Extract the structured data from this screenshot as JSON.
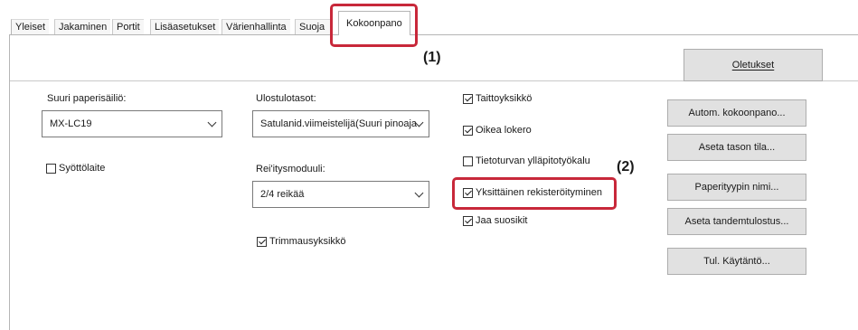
{
  "tabs": [
    {
      "label": "Yleiset"
    },
    {
      "label": "Jakaminen"
    },
    {
      "label": "Portit"
    },
    {
      "label": "Lisäasetukset"
    },
    {
      "label": "Värienhallinta"
    },
    {
      "label": "Suoja"
    },
    {
      "label": "Kokoonpano"
    }
  ],
  "left": {
    "tray_label": "Suuri paperisäiliö:",
    "tray_value": "MX-LC19",
    "feeder_label": "Syöttölaite",
    "feeder_checked": false
  },
  "middle": {
    "output_label": "Ulostulotasot:",
    "output_value": "Satulanid.viimeistelijä(Suuri pinoaja",
    "punch_label": "Rei'itysmoduuli:",
    "punch_value": "2/4 reikää",
    "trim_label": "Trimmausyksikkö",
    "trim_checked": true
  },
  "options": [
    {
      "label": "Taittoyksikkö",
      "checked": true
    },
    {
      "label": "Oikea lokero",
      "checked": true
    },
    {
      "label": "Tietoturvan ylläpitotyökalu",
      "checked": false
    },
    {
      "label": "Yksittäinen rekisteröityminen",
      "checked": true
    },
    {
      "label": "Jaa suosikit",
      "checked": true
    }
  ],
  "buttons": {
    "defaults": "Oletukset",
    "auto_config": "Autom. kokoonpano...",
    "tray_status": "Aseta tason tila...",
    "paper_type": "Paperityypin nimi...",
    "tandem": "Aseta tandemtulostus...",
    "policy": "Tul. Käytäntö..."
  },
  "callouts": {
    "one": "(1)",
    "two": "(2)"
  },
  "colors": {
    "highlight": "#c8283a"
  }
}
